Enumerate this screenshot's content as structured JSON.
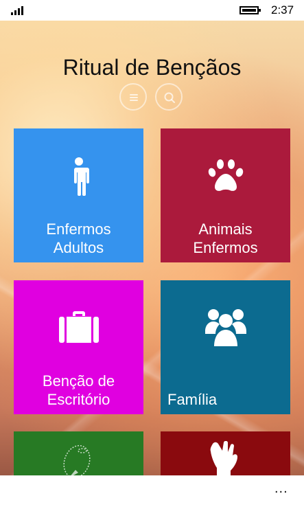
{
  "status_bar": {
    "time": "2:37"
  },
  "app": {
    "title": "Ritual de Bençãos",
    "toolbar": {
      "list_icon": "list-icon",
      "search_icon": "search-icon"
    },
    "tiles": [
      {
        "lines": [
          "Enfermos",
          "Adultos"
        ],
        "icon": "person-icon",
        "color": "#3593ee"
      },
      {
        "lines": [
          "Animais",
          "Enfermos"
        ],
        "icon": "paw-icon",
        "color": "#ab1a3c"
      },
      {
        "lines": [
          "Benção de",
          "Escritório"
        ],
        "icon": "briefcase-icon",
        "color": "#e000e0"
      },
      {
        "lines": [
          "Família"
        ],
        "icon": "group-icon",
        "color": "#0c6b90"
      },
      {
        "lines": [],
        "icon": "rosary-icon",
        "color": "#277a24"
      },
      {
        "lines": [],
        "icon": "blessing-hand-icon",
        "color": "#8a0a0e"
      }
    ]
  },
  "app_bar": {
    "more_label": "..."
  }
}
